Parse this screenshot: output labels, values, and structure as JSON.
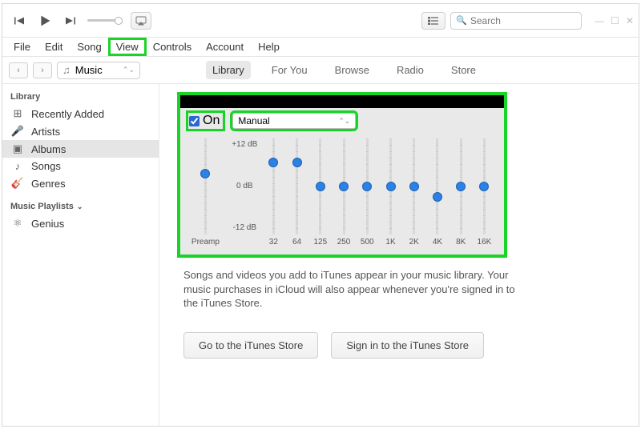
{
  "titlebar": {
    "search_placeholder": "Search"
  },
  "menubar": [
    "File",
    "Edit",
    "Song",
    "View",
    "Controls",
    "Account",
    "Help"
  ],
  "menubar_highlight_index": 3,
  "toolbar": {
    "source": "Music",
    "tabs": [
      "Library",
      "For You",
      "Browse",
      "Radio",
      "Store"
    ],
    "active_tab_index": 0
  },
  "sidebar": {
    "section_library": "Library",
    "library_items": [
      {
        "icon": "clock",
        "label": "Recently Added"
      },
      {
        "icon": "mic",
        "label": "Artists"
      },
      {
        "icon": "album",
        "label": "Albums"
      },
      {
        "icon": "note",
        "label": "Songs"
      },
      {
        "icon": "guitar",
        "label": "Genres"
      }
    ],
    "library_selected_index": 2,
    "section_playlists": "Music Playlists",
    "playlist_items": [
      {
        "icon": "genius",
        "label": "Genius"
      }
    ]
  },
  "equalizer": {
    "on_label": "On",
    "on_checked": true,
    "preset": "Manual",
    "db_labels": {
      "top": "+12 dB",
      "mid": "0 dB",
      "bot": "-12 dB"
    },
    "preamp_label": "Preamp",
    "preamp_value_pct": 35,
    "bands": [
      {
        "label": "32",
        "value_pct": 22
      },
      {
        "label": "64",
        "value_pct": 22
      },
      {
        "label": "125",
        "value_pct": 50
      },
      {
        "label": "250",
        "value_pct": 50
      },
      {
        "label": "500",
        "value_pct": 50
      },
      {
        "label": "1K",
        "value_pct": 50
      },
      {
        "label": "2K",
        "value_pct": 50
      },
      {
        "label": "4K",
        "value_pct": 62
      },
      {
        "label": "8K",
        "value_pct": 50
      },
      {
        "label": "16K",
        "value_pct": 50
      }
    ]
  },
  "content": {
    "info_text": "Songs and videos you add to iTunes appear in your music library. Your music purchases in iCloud will also appear whenever you're signed in to the iTunes Store.",
    "btn_store": "Go to the iTunes Store",
    "btn_signin": "Sign in to the iTunes Store"
  }
}
